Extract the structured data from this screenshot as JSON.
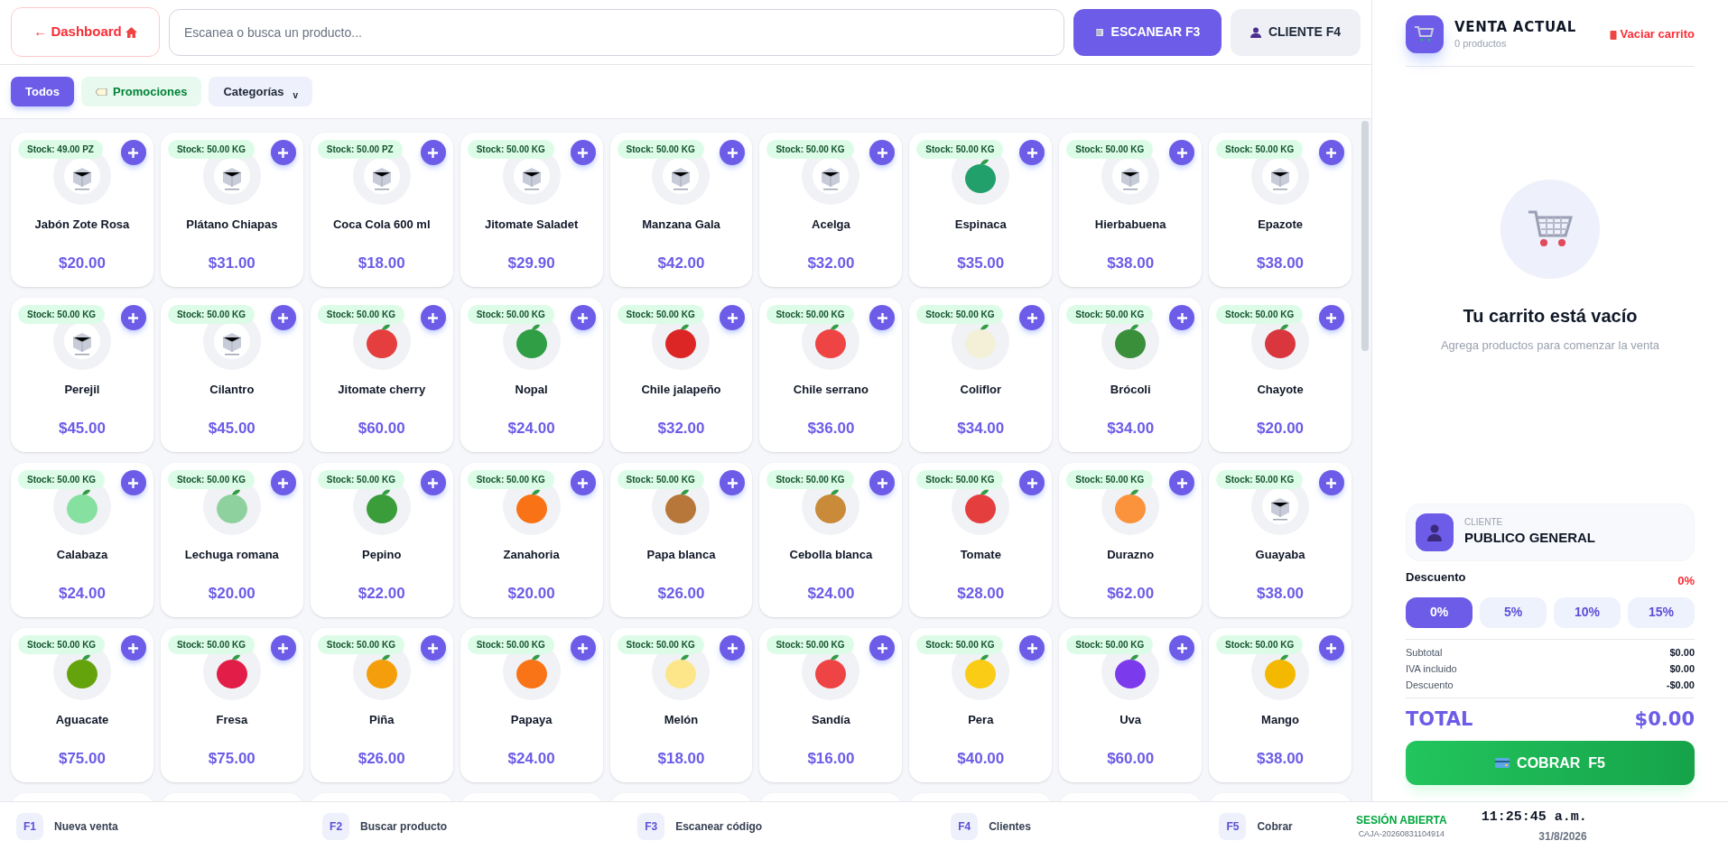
{
  "top_bar": {
    "dashboard_button": "← Dashboard",
    "search": {
      "placeholder": "Escanea o busca un producto..."
    },
    "scan_button": "ESCANEAR F3",
    "client_button": "CLIENTE F4"
  },
  "filters": [
    {
      "label": "Todos",
      "kind": "all",
      "selected": true
    },
    {
      "label": "Promociones",
      "kind": "promo",
      "selected": false
    },
    {
      "label": "Categorías",
      "kind": "dropdown",
      "selected": false,
      "caret": "v"
    }
  ],
  "products": [
    {
      "name": "Jabón Zote Rosa",
      "price": "$20.00",
      "stock": "Stock: 49.00 PZ",
      "kind": "placeholder"
    },
    {
      "name": "Plátano Chiapas",
      "price": "$31.00",
      "stock": "Stock: 50.00 KG",
      "kind": "placeholder"
    },
    {
      "name": "Coca Cola 600 ml",
      "price": "$18.00",
      "stock": "Stock: 50.00 PZ",
      "kind": "placeholder"
    },
    {
      "name": "Jitomate Saladet",
      "price": "$29.90",
      "stock": "Stock: 50.00 KG",
      "kind": "placeholder"
    },
    {
      "name": "Manzana Gala",
      "price": "$42.00",
      "stock": "Stock: 50.00 KG",
      "kind": "placeholder"
    },
    {
      "name": "Acelga",
      "price": "$32.00",
      "stock": "Stock: 50.00 KG",
      "kind": "placeholder"
    },
    {
      "name": "Espinaca",
      "price": "$35.00",
      "stock": "Stock: 50.00 KG",
      "kind": "produce",
      "color": "#22a06b"
    },
    {
      "name": "Hierbabuena",
      "price": "$38.00",
      "stock": "Stock: 50.00 KG",
      "kind": "placeholder"
    },
    {
      "name": "Epazote",
      "price": "$38.00",
      "stock": "Stock: 50.00 KG",
      "kind": "placeholder"
    },
    {
      "name": "Perejil",
      "price": "$45.00",
      "stock": "Stock: 50.00 KG",
      "kind": "placeholder"
    },
    {
      "name": "Cilantro",
      "price": "$45.00",
      "stock": "Stock: 50.00 KG",
      "kind": "placeholder"
    },
    {
      "name": "Jitomate cherry",
      "price": "$60.00",
      "stock": "Stock: 50.00 KG",
      "kind": "produce",
      "color": "#e53e3e"
    },
    {
      "name": "Nopal",
      "price": "$24.00",
      "stock": "Stock: 50.00 KG",
      "kind": "produce",
      "color": "#2f9e44"
    },
    {
      "name": "Chile jalapeño",
      "price": "$32.00",
      "stock": "Stock: 50.00 KG",
      "kind": "produce",
      "color": "#dc2626"
    },
    {
      "name": "Chile serrano",
      "price": "$36.00",
      "stock": "Stock: 50.00 KG",
      "kind": "produce",
      "color": "#ef4444"
    },
    {
      "name": "Coliflor",
      "price": "$34.00",
      "stock": "Stock: 50.00 KG",
      "kind": "produce",
      "color": "#f3f0d7"
    },
    {
      "name": "Brócoli",
      "price": "$34.00",
      "stock": "Stock: 50.00 KG",
      "kind": "produce",
      "color": "#3a8f3a"
    },
    {
      "name": "Chayote",
      "price": "$20.00",
      "stock": "Stock: 50.00 KG",
      "kind": "produce",
      "color": "#d9363e"
    },
    {
      "name": "Calabaza",
      "price": "$24.00",
      "stock": "Stock: 50.00 KG",
      "kind": "produce",
      "color": "#86e0a0"
    },
    {
      "name": "Lechuga romana",
      "price": "$20.00",
      "stock": "Stock: 50.00 KG",
      "kind": "produce",
      "color": "#8fd19e"
    },
    {
      "name": "Pepino",
      "price": "$22.00",
      "stock": "Stock: 50.00 KG",
      "kind": "produce",
      "color": "#3a9d3a"
    },
    {
      "name": "Zanahoria",
      "price": "$20.00",
      "stock": "Stock: 50.00 KG",
      "kind": "produce",
      "color": "#f97316"
    },
    {
      "name": "Papa blanca",
      "price": "$26.00",
      "stock": "Stock: 50.00 KG",
      "kind": "produce",
      "color": "#b7773a"
    },
    {
      "name": "Cebolla blanca",
      "price": "$24.00",
      "stock": "Stock: 50.00 KG",
      "kind": "produce",
      "color": "#c98b3a"
    },
    {
      "name": "Tomate",
      "price": "$28.00",
      "stock": "Stock: 50.00 KG",
      "kind": "produce",
      "color": "#e53e3f"
    },
    {
      "name": "Durazno",
      "price": "$62.00",
      "stock": "Stock: 50.00 KG",
      "kind": "produce",
      "color": "#fb923c"
    },
    {
      "name": "Guayaba",
      "price": "$38.00",
      "stock": "Stock: 50.00 KG",
      "kind": "placeholder"
    },
    {
      "name": "Aguacate",
      "price": "$75.00",
      "stock": "Stock: 50.00 KG",
      "kind": "produce",
      "color": "#65a30d"
    },
    {
      "name": "Fresa",
      "price": "$75.00",
      "stock": "Stock: 50.00 KG",
      "kind": "produce",
      "color": "#e11d48"
    },
    {
      "name": "Piña",
      "price": "$26.00",
      "stock": "Stock: 50.00 KG",
      "kind": "produce",
      "color": "#f59e0b"
    },
    {
      "name": "Papaya",
      "price": "$24.00",
      "stock": "Stock: 50.00 KG",
      "kind": "produce",
      "color": "#f97317"
    },
    {
      "name": "Melón",
      "price": "$18.00",
      "stock": "Stock: 50.00 KG",
      "kind": "produce",
      "color": "#fde68a"
    },
    {
      "name": "Sandía",
      "price": "$16.00",
      "stock": "Stock: 50.00 KG",
      "kind": "produce",
      "color": "#ef4445"
    },
    {
      "name": "Pera",
      "price": "$40.00",
      "stock": "Stock: 50.00 KG",
      "kind": "produce",
      "color": "#facc15"
    },
    {
      "name": "Uva",
      "price": "$60.00",
      "stock": "Stock: 50.00 KG",
      "kind": "produce",
      "color": "#7c3aed"
    },
    {
      "name": "Mango",
      "price": "$38.00",
      "stock": "Stock: 50.00 KG",
      "kind": "produce",
      "color": "#f5b800"
    }
  ],
  "cart": {
    "title": "VENTA ACTUAL",
    "count": "0 productos",
    "clear_button": "Vaciar carrito",
    "empty_title": "Tu carrito está vacío",
    "empty_hint": "Agrega productos para comenzar la venta",
    "client": {
      "label": "CLIENTE",
      "name": "PUBLICO GENERAL"
    },
    "discount": {
      "label": "Descuento",
      "value": "0%",
      "options": [
        {
          "label": "0%",
          "selected": true
        },
        {
          "label": "5%",
          "selected": false
        },
        {
          "label": "10%",
          "selected": false
        },
        {
          "label": "15%",
          "selected": false
        }
      ]
    },
    "summary": [
      {
        "label": "Subtotal",
        "value": "$0.00"
      },
      {
        "label": "IVA incluido",
        "value": "$0.00"
      },
      {
        "label": "Descuento",
        "value": "-$0.00"
      }
    ],
    "total": {
      "label": "TOTAL",
      "value": "$0.00"
    },
    "pay_button": "COBRAR  F5"
  },
  "status_bar": {
    "shortcuts": [
      {
        "key": "F1",
        "label": "Nueva venta"
      },
      {
        "key": "F2",
        "label": "Buscar producto"
      },
      {
        "key": "F3",
        "label": "Escanear código"
      },
      {
        "key": "F4",
        "label": "Clientes"
      },
      {
        "key": "F5",
        "label": "Cobrar"
      }
    ],
    "session": "SESIÓN ABIERTA",
    "register": "CAJA-20260831104914",
    "time": "11:25:45 a.m.",
    "date": "31/8/2026"
  }
}
